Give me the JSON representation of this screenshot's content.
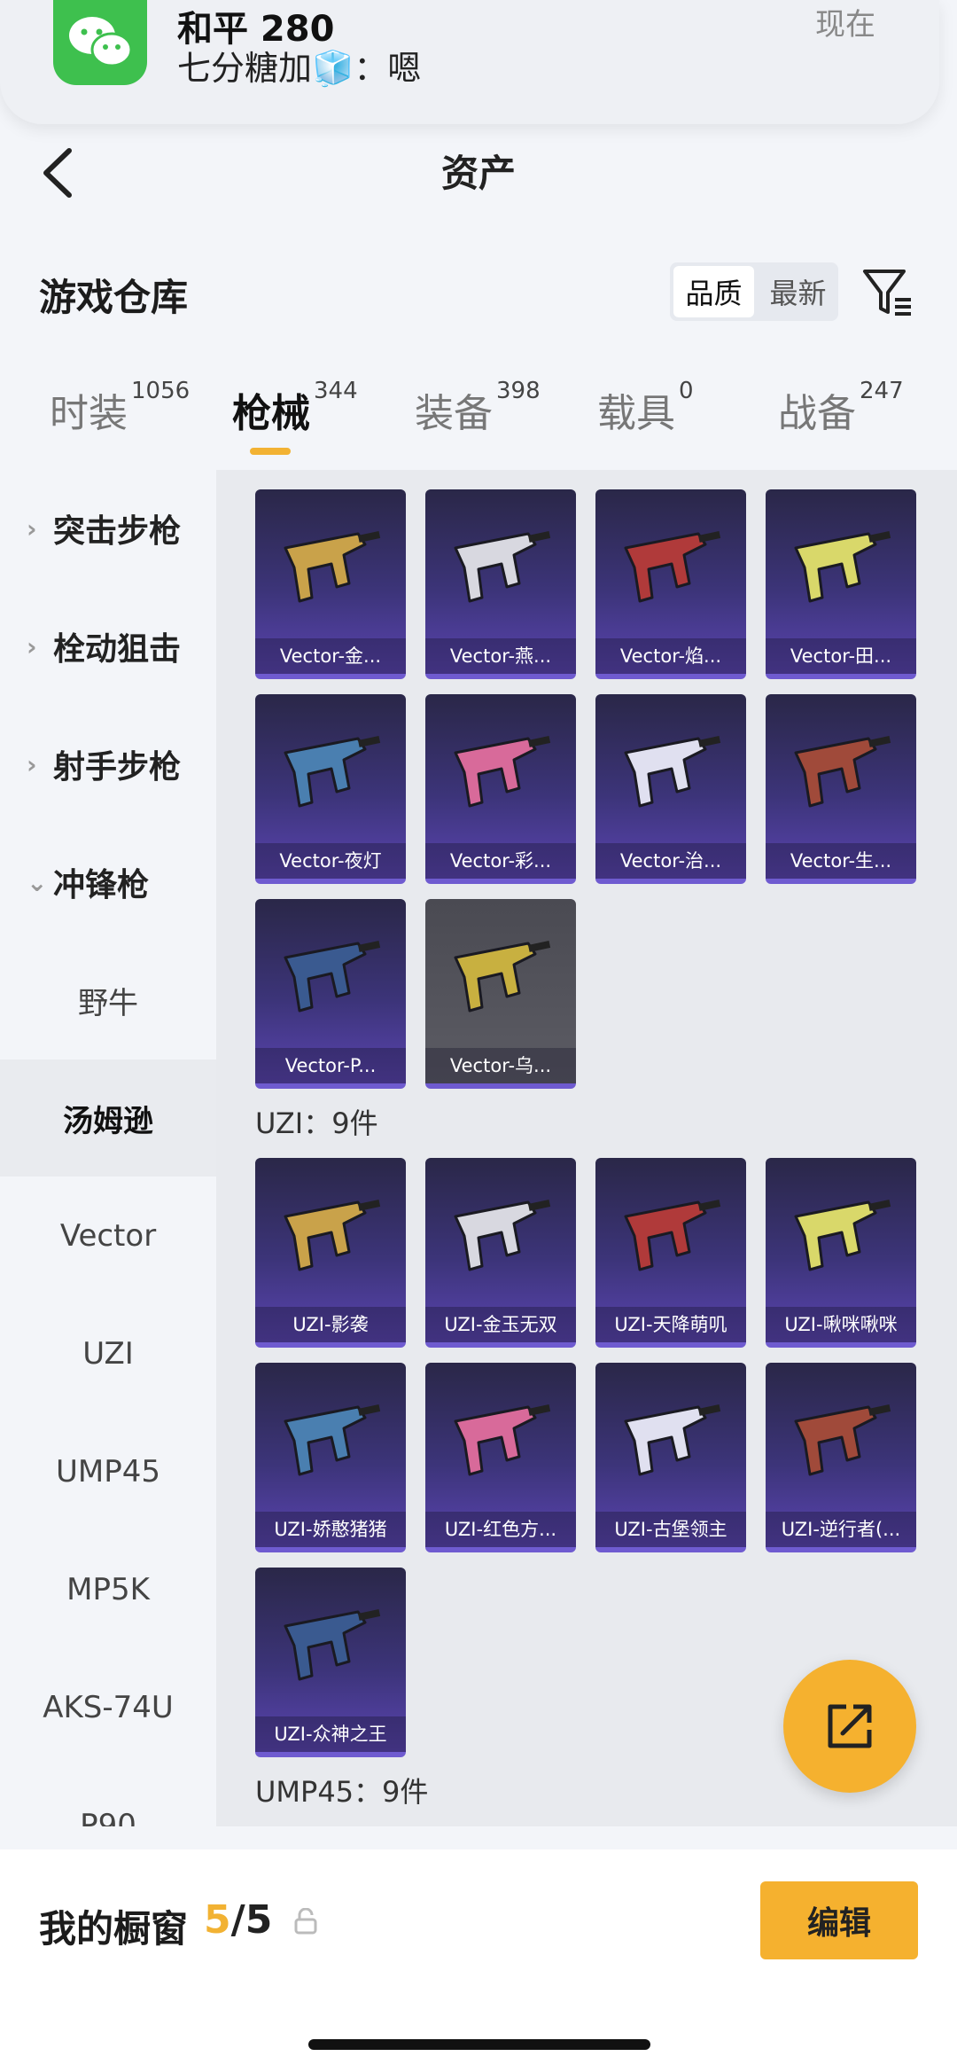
{
  "notification": {
    "app_name": "和平 280",
    "message": "七分糖加🧊：嗯",
    "time": "现在"
  },
  "header": {
    "title": "资产"
  },
  "warehouse": {
    "title": "游戏仓库",
    "sort_quality": "品质",
    "sort_latest": "最新"
  },
  "tabs": [
    {
      "label": "时装",
      "count": "1056"
    },
    {
      "label": "枪械",
      "count": "344"
    },
    {
      "label": "装备",
      "count": "398"
    },
    {
      "label": "载具",
      "count": "0"
    },
    {
      "label": "战备",
      "count": "247"
    }
  ],
  "sidebar": {
    "categories": [
      "突击步枪",
      "栓动狙击",
      "射手步枪",
      "冲锋枪"
    ],
    "subitems": [
      "野牛",
      "汤姆逊",
      "Vector",
      "UZI",
      "UMP45",
      "MP5K",
      "AKS-74U",
      "P90"
    ],
    "selected": "汤姆逊"
  },
  "vector_items": [
    "Vector-金...",
    "Vector-燕...",
    "Vector-焰...",
    "Vector-田...",
    "Vector-夜灯",
    "Vector-彩...",
    "Vector-治...",
    "Vector-生...",
    "Vector-P...",
    "Vector-乌..."
  ],
  "uzi_group": {
    "label": "UZI：9件"
  },
  "uzi_items": [
    "UZI-影袭",
    "UZI-金玉无双",
    "UZI-天降萌叽",
    "UZI-啾咪啾咪",
    "UZI-娇憨猪猪",
    "UZI-红色方...",
    "UZI-古堡领主",
    "UZI-逆行者(...",
    "UZI-众神之王"
  ],
  "ump_group": {
    "label": "UMP45：9件"
  },
  "bottom": {
    "window_label": "我的橱窗",
    "window_current": "5",
    "window_total": "/5",
    "edit_label": "编辑"
  },
  "colors": {
    "accent": "#f5b12f",
    "card_purple": "#5a44b0",
    "wechat_green": "#3ec04e"
  }
}
